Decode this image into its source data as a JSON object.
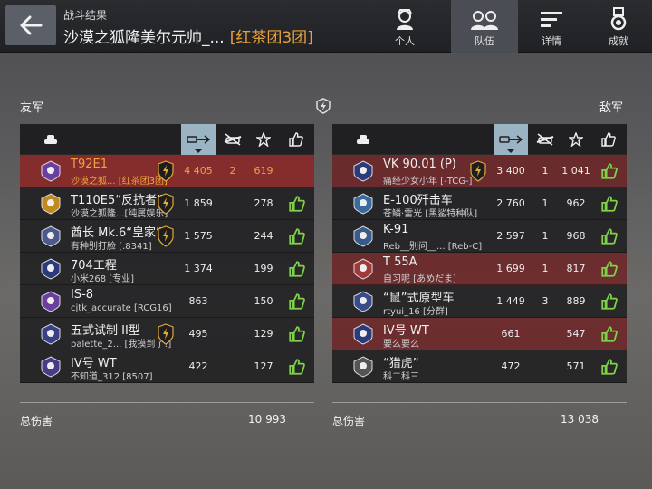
{
  "header": {
    "subtitle": "战斗结果",
    "title": "沙漠之狐隆美尔元帅_...",
    "clan_tag": "[红茶团3团]",
    "tabs": [
      {
        "label": "个人",
        "icon": "player-icon",
        "active": false
      },
      {
        "label": "队伍",
        "icon": "team-icon",
        "active": true
      },
      {
        "label": "详情",
        "icon": "list-icon",
        "active": false
      },
      {
        "label": "成就",
        "icon": "medal-icon",
        "active": false
      }
    ]
  },
  "allies": {
    "label": "友军",
    "total_label": "总伤害",
    "total": "10 993",
    "rows": [
      {
        "name": "T92E1",
        "sub": "沙漠之狐...  [红茶团3团]",
        "damage": "4 405",
        "kills": "2",
        "xp": "619",
        "me": true,
        "style": "red-strong",
        "crest": true,
        "like": false
      },
      {
        "name": "T110E5“反抗者”",
        "sub": "沙漠之狐隆...[纯属娱乐]",
        "damage": "1 859",
        "kills": "",
        "xp": "278",
        "style": "dark",
        "crest": true,
        "like": true
      },
      {
        "name": "酋长 Mk.6“皇家”",
        "sub": "有种别打脸 [.8341]",
        "damage": "1 575",
        "kills": "",
        "xp": "244",
        "style": "dark",
        "crest": true,
        "like": true
      },
      {
        "name": "704工程",
        "sub": "小米268 [专业]",
        "damage": "1 374",
        "kills": "",
        "xp": "199",
        "style": "dark",
        "crest": false,
        "like": true
      },
      {
        "name": "IS-8",
        "sub": "cjtk_accurate [RCG16]",
        "damage": "863",
        "kills": "",
        "xp": "150",
        "style": "dark",
        "crest": false,
        "like": true
      },
      {
        "name": "五式试制 II型",
        "sub": "palette_2...  [我摸到了!]",
        "damage": "495",
        "kills": "",
        "xp": "129",
        "style": "dark",
        "crest": true,
        "like": true
      },
      {
        "name": "IV号 WT",
        "sub": "不知道_312 [8507]",
        "damage": "422",
        "kills": "",
        "xp": "127",
        "style": "dark",
        "crest": false,
        "like": true
      }
    ]
  },
  "enemies": {
    "label": "敌军",
    "total_label": "总伤害",
    "total": "13 038",
    "rows": [
      {
        "name": "VK 90.01 (P)",
        "sub": "痛经少女小年 [-TCG-]",
        "damage": "3 400",
        "kills": "1",
        "xp": "1 041",
        "style": "red",
        "crest": true,
        "like": true
      },
      {
        "name": "E-100歼击车",
        "sub": "苍鳞·雷光 [黑鲨特种队]",
        "damage": "2 760",
        "kills": "1",
        "xp": "962",
        "style": "dark",
        "crest": false,
        "like": true
      },
      {
        "name": "K-91",
        "sub": "Reb__别问__...  [Reb-C]",
        "damage": "2 597",
        "kills": "1",
        "xp": "968",
        "style": "dark",
        "crest": false,
        "like": true
      },
      {
        "name": "T 55A",
        "sub": "自习呢 [あめだま]",
        "damage": "1 699",
        "kills": "1",
        "xp": "817",
        "style": "red",
        "crest": false,
        "like": true
      },
      {
        "name": "“鼠”式原型车",
        "sub": "rtyui_16 [分群]",
        "damage": "1 449",
        "kills": "3",
        "xp": "889",
        "style": "dark",
        "crest": false,
        "like": true
      },
      {
        "name": "IV号 WT",
        "sub": "要么要么",
        "damage": "661",
        "kills": "",
        "xp": "547",
        "style": "red",
        "crest": false,
        "like": true
      },
      {
        "name": "“猎虎”",
        "sub": "科二科三",
        "damage": "472",
        "kills": "",
        "xp": "571",
        "style": "dark",
        "crest": false,
        "like": true
      }
    ]
  },
  "colors": {
    "accent": "#f0a13c",
    "like": "#7fd14a",
    "sorted_col": "#9bb4c4"
  }
}
